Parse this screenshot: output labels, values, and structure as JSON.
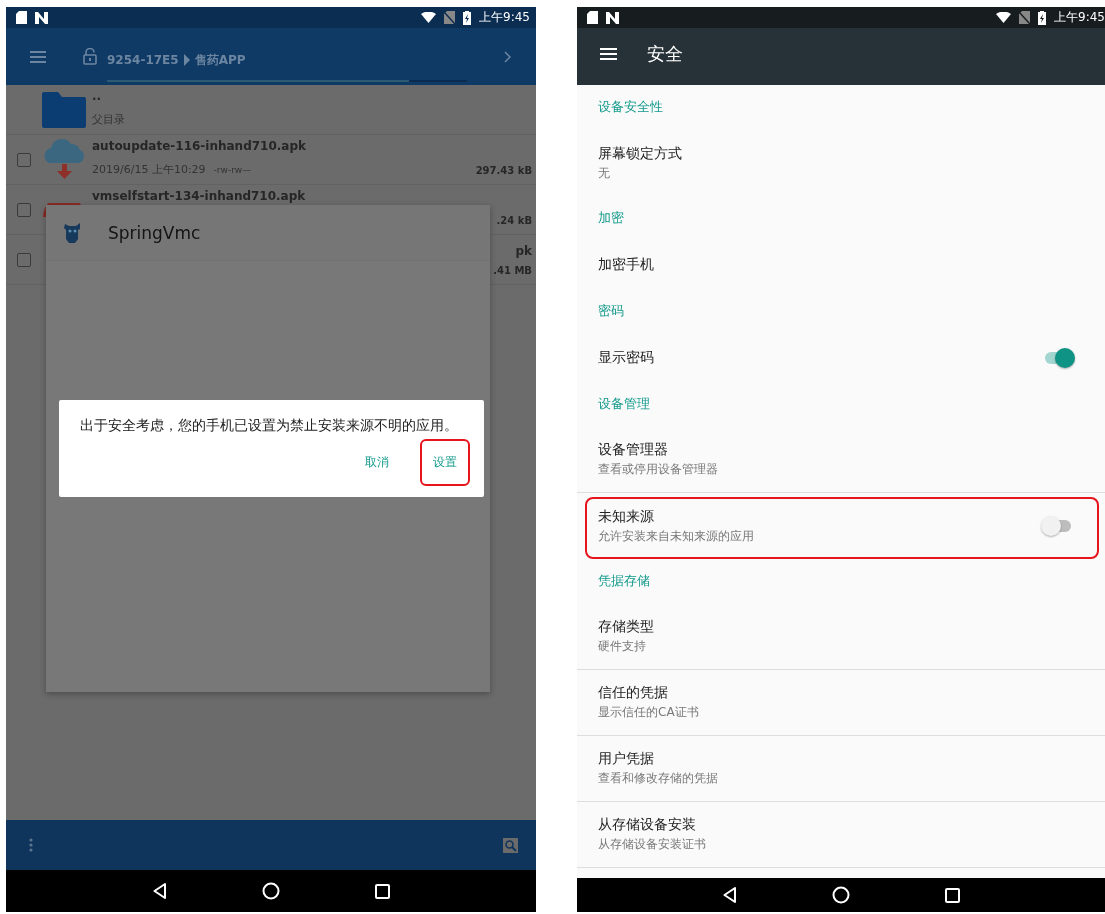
{
  "left_screen": {
    "status_bar": {
      "time": "上午9:45"
    },
    "toolbar": {
      "path": [
        "9254-17E5",
        "售药APP"
      ]
    },
    "files": [
      {
        "kind": "folder",
        "name": "..",
        "detail": "父目录"
      },
      {
        "kind": "download",
        "name": "autoupdate-116-inhand710.apk",
        "date": "2019/6/15 上午10:29",
        "permissions": "-rw-rw—",
        "size": "297.43 kB",
        "checked": false
      },
      {
        "kind": "app",
        "name": "vmselfstart-134-inhand710.apk",
        "size": ".24 kB",
        "checked": false
      },
      {
        "kind": "app",
        "name": "pk",
        "size": ".41 MB",
        "checked": false
      }
    ],
    "app_dialog": {
      "title": "SpringVmc"
    },
    "alert": {
      "message": "出于安全考虑，您的手机已设置为禁止安装来源不明的应用。",
      "buttons": [
        {
          "label": "取消",
          "highlighted": false
        },
        {
          "label": "设置",
          "highlighted": true
        }
      ]
    }
  },
  "right_screen": {
    "status_bar": {
      "time": "上午9:45"
    },
    "toolbar": {
      "title": "安全"
    },
    "items": [
      {
        "kind": "header",
        "title": "设备安全性"
      },
      {
        "kind": "item",
        "title": "屏幕锁定方式",
        "summary": "无",
        "divider": false,
        "highlighted": false
      },
      {
        "kind": "header",
        "title": "加密"
      },
      {
        "kind": "item",
        "title": "加密手机",
        "divider": false,
        "highlighted": false
      },
      {
        "kind": "header",
        "title": "密码"
      },
      {
        "kind": "switch",
        "title": "显示密码",
        "on": true,
        "divider": false,
        "highlighted": false
      },
      {
        "kind": "header",
        "title": "设备管理"
      },
      {
        "kind": "item",
        "title": "设备管理器",
        "summary": "查看或停用设备管理器",
        "divider": true,
        "highlighted": false
      },
      {
        "kind": "switch",
        "title": "未知来源",
        "summary": "允许安装来自未知来源的应用",
        "on": false,
        "divider": false,
        "highlighted": true
      },
      {
        "kind": "header",
        "title": "凭据存储"
      },
      {
        "kind": "item",
        "title": "存储类型",
        "summary": "硬件支持",
        "divider": true,
        "highlighted": false
      },
      {
        "kind": "item",
        "title": "信任的凭据",
        "summary": "显示信任的CA证书",
        "divider": true,
        "highlighted": false
      },
      {
        "kind": "item",
        "title": "用户凭据",
        "summary": "查看和修改存储的凭据",
        "divider": true,
        "highlighted": false
      },
      {
        "kind": "item",
        "title": "从存储设备安装",
        "summary": "从存储设备安装证书",
        "divider": true,
        "highlighted": false
      }
    ]
  }
}
